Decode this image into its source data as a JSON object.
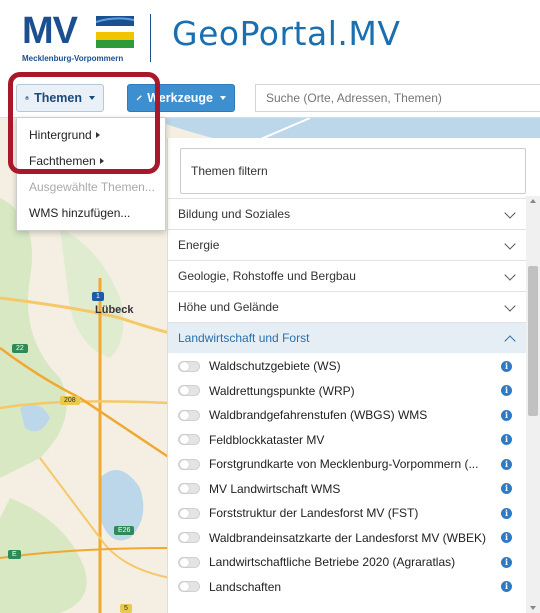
{
  "header": {
    "logo_text": "MV",
    "logo_subtitle": "Mecklenburg-Vorpommern",
    "portal_title": "GeoPortal.MV"
  },
  "toolbar": {
    "themen_label": "Themen",
    "werkzeuge_label": "Werkzeuge",
    "search_placeholder": "Suche (Orte, Adressen, Themen)"
  },
  "themen_menu": {
    "items": [
      {
        "label": "Hintergrund"
      },
      {
        "label": "Fachthemen"
      },
      {
        "label": "Ausgewählte Themen..."
      },
      {
        "label": "WMS hinzufügen..."
      }
    ]
  },
  "panel": {
    "filter_label": "Themen filtern",
    "categories": [
      {
        "label": "Bildung und Soziales"
      },
      {
        "label": "Energie"
      },
      {
        "label": "Geologie, Rohstoffe und Bergbau"
      },
      {
        "label": "Höhe und Gelände"
      },
      {
        "label": "Landwirtschaft und Forst"
      }
    ],
    "layers": [
      {
        "label": "Waldschutzgebiete (WS)"
      },
      {
        "label": "Waldrettungspunkte (WRP)"
      },
      {
        "label": "Waldbrandgefahrenstufen (WBGS) WMS"
      },
      {
        "label": "Feldblockkataster MV"
      },
      {
        "label": "Forstgrundkarte von Mecklenburg-Vorpommern (..."
      },
      {
        "label": "MV Landwirtschaft WMS"
      },
      {
        "label": "Forststruktur der Landesforst MV (FST)"
      },
      {
        "label": "Waldbrandeinsatzkarte der Landesforst MV (WBEK)"
      },
      {
        "label": "Landwirtschaftliche Betriebe 2020 (Agraratlas)"
      },
      {
        "label": "Landschaften"
      }
    ]
  },
  "map": {
    "city_label": "Lübeck",
    "shields": [
      "1",
      "22",
      "208",
      "E26",
      "5",
      "E"
    ]
  },
  "colors": {
    "brand_blue": "#1b4f8f",
    "accent_blue": "#3e8fd0",
    "highlight_red": "#a8182a",
    "open_category": "#2b6ea8"
  }
}
